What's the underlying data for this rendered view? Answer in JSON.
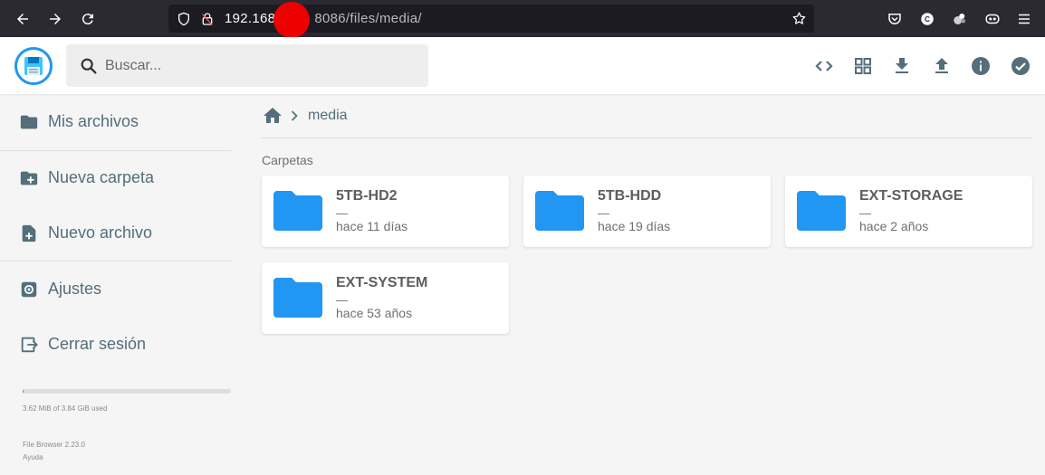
{
  "browser": {
    "url_host": "192.168",
    "url_path": "8086/files/media/"
  },
  "search": {
    "placeholder": "Buscar..."
  },
  "sidebar": {
    "items": [
      {
        "label": "Mis archivos",
        "icon": "folder-icon"
      },
      {
        "label": "Nueva carpeta",
        "icon": "new-folder-icon"
      },
      {
        "label": "Nuevo archivo",
        "icon": "new-file-icon"
      },
      {
        "label": "Ajustes",
        "icon": "settings-icon"
      },
      {
        "label": "Cerrar sesión",
        "icon": "logout-icon"
      }
    ],
    "usage_text": "3.62 MiB of 3.84 GiB used",
    "usage_fraction": 0.001,
    "footer_version": "File Browser 2.23.0",
    "footer_help": "Ayuda"
  },
  "breadcrumb": {
    "current": "media"
  },
  "main": {
    "section_title": "Carpetas",
    "folders": [
      {
        "name": "5TB-HD2",
        "size": "—",
        "date": "hace 11 días"
      },
      {
        "name": "5TB-HDD",
        "size": "—",
        "date": "hace 19 días"
      },
      {
        "name": "EXT-STORAGE",
        "size": "—",
        "date": "hace 2 años"
      },
      {
        "name": "EXT-SYSTEM",
        "size": "—",
        "date": "hace 53 años"
      }
    ]
  },
  "colors": {
    "accent": "#2196f3",
    "text_muted": "#546e7a",
    "browser_bg": "#2b2a33"
  }
}
